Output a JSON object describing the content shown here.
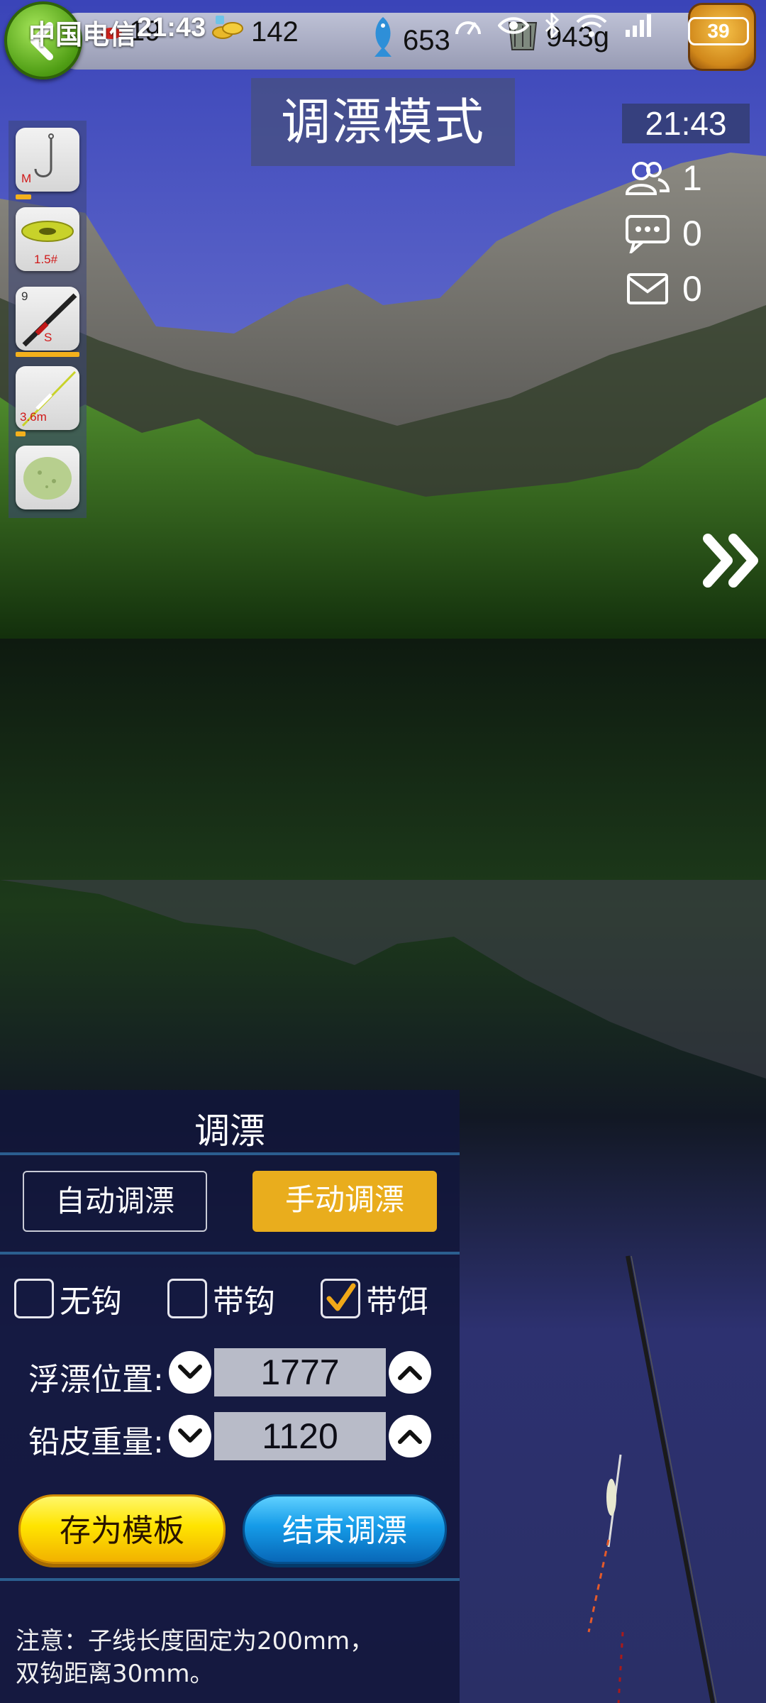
{
  "status_bar": {
    "carrier": "中国电信",
    "time": "21:43",
    "battery": "39"
  },
  "resources": {
    "bait_count": "19",
    "coins": "142",
    "fish": "653",
    "weight": "943g"
  },
  "mode_title": "调漂模式",
  "clock": "21:43",
  "social": {
    "online_count": "1",
    "chat_count": "0",
    "mail_count": "0"
  },
  "gear": {
    "hook_label": "M",
    "line_label": "1.5#",
    "rod_number": "9",
    "rod_label": "S",
    "rod_length": "3.6m"
  },
  "panel": {
    "title": "调漂",
    "auto_label": "自动调漂",
    "manual_label": "手动调漂",
    "options": [
      {
        "label": "无钩",
        "checked": false
      },
      {
        "label": "带钩",
        "checked": false
      },
      {
        "label": "带饵",
        "checked": true
      }
    ],
    "float_position": {
      "label": "浮漂位置:",
      "value": "1777"
    },
    "sinker_weight": {
      "label": "铅皮重量:",
      "value": "1120"
    },
    "save_label": "存为模板",
    "end_label": "结束调漂",
    "note_line1": "注意：子线长度固定为200mm，",
    "note_line2": "双钩距离30mm。"
  },
  "colors": {
    "accent_yellow": "#e9ad1d",
    "panel_bg": "#12163a",
    "divider": "#2b5e8f"
  }
}
